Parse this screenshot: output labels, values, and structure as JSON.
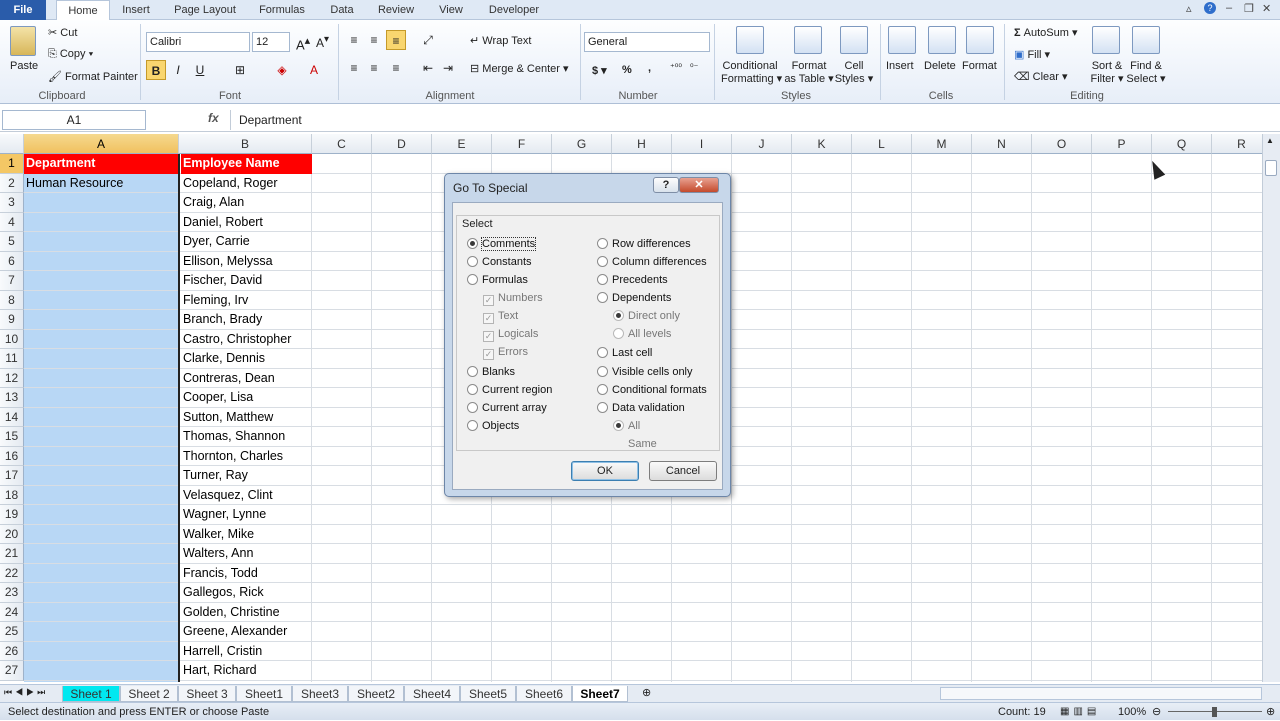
{
  "ribbon_tabs": [
    "File",
    "Home",
    "Insert",
    "Page Layout",
    "Formulas",
    "Data",
    "Review",
    "View",
    "Developer"
  ],
  "clipboard": {
    "paste": "Paste",
    "cut": "Cut",
    "copy": "Copy ▾",
    "format_painter": "Format Painter",
    "label": "Clipboard"
  },
  "font": {
    "name": "Calibri",
    "size": "12",
    "label": "Font",
    "bold": "B",
    "italic": "I",
    "underline": "U"
  },
  "alignment": {
    "wrap": "Wrap Text",
    "merge": "Merge & Center ▾",
    "label": "Alignment"
  },
  "number": {
    "format": "General",
    "label": "Number",
    "currency": "$ ▾",
    "percent": "%",
    "comma": ","
  },
  "styles": {
    "cond1": "Conditional",
    "cond2": "Formatting ▾",
    "fmt1": "Format",
    "fmt2": "as Table ▾",
    "cell1": "Cell",
    "cell2": "Styles ▾",
    "label": "Styles"
  },
  "cells": {
    "insert": "Insert",
    "delete": "Delete",
    "format": "Format",
    "label": "Cells"
  },
  "editing": {
    "autosum": "AutoSum ▾",
    "fill": "Fill ▾",
    "clear": "Clear ▾",
    "sort1": "Sort &",
    "sort2": "Filter ▾",
    "find1": "Find &",
    "find2": "Select ▾",
    "label": "Editing"
  },
  "formula_bar": {
    "name_box": "A1",
    "fx": "fx",
    "content": "Department"
  },
  "columns": [
    "A",
    "B",
    "C",
    "D",
    "E",
    "F",
    "G",
    "H",
    "I",
    "J",
    "K",
    "L",
    "M",
    "N",
    "O",
    "P",
    "Q",
    "R"
  ],
  "rows": [
    "1",
    "2",
    "3",
    "4",
    "5",
    "6",
    "7",
    "8",
    "9",
    "10",
    "11",
    "12",
    "13",
    "14",
    "15",
    "16",
    "17",
    "18",
    "19",
    "20",
    "21",
    "22",
    "23",
    "24",
    "25",
    "26",
    "27"
  ],
  "colA": [
    "Department",
    "Human Resource"
  ],
  "colB": [
    "Employee Name",
    "Copeland, Roger",
    "Craig, Alan",
    "Daniel, Robert",
    "Dyer, Carrie",
    "Ellison, Melyssa",
    "Fischer, David",
    "Fleming, Irv",
    "Branch, Brady",
    "Castro, Christopher",
    "Clarke, Dennis",
    "Contreras, Dean",
    "Cooper, Lisa",
    "Sutton, Matthew",
    "Thomas, Shannon",
    "Thornton, Charles",
    "Turner, Ray",
    "Velasquez, Clint",
    "Wagner, Lynne",
    "Walker, Mike",
    "Walters, Ann",
    "Francis, Todd",
    "Gallegos, Rick",
    "Golden, Christine",
    "Greene, Alexander",
    "Harrell, Cristin",
    "Hart, Richard"
  ],
  "dialog": {
    "title": "Go To Special",
    "help": "?",
    "close": "✕",
    "group": "Select",
    "left_options": [
      "Comments",
      "Constants",
      "Formulas"
    ],
    "formula_subs": [
      "Numbers",
      "Text",
      "Logicals",
      "Errors"
    ],
    "left_options2": [
      "Blanks",
      "Current region",
      "Current array",
      "Objects"
    ],
    "right_options": [
      "Row differences",
      "Column differences",
      "Precedents",
      "Dependents"
    ],
    "dep_subs": [
      "Direct only",
      "All levels"
    ],
    "right_options2": [
      "Last cell",
      "Visible cells only",
      "Conditional formats",
      "Data validation"
    ],
    "dv_subs": [
      "All",
      "Same"
    ],
    "ok": "OK",
    "cancel": "Cancel"
  },
  "sheets": [
    "Sheet 1",
    "Sheet 2",
    "Sheet 3",
    "Sheet1",
    "Sheet3",
    "Sheet2",
    "Sheet4",
    "Sheet5",
    "Sheet6",
    "Sheet7"
  ],
  "status": {
    "message": "Select destination and press ENTER or choose Paste",
    "count": "Count: 19",
    "zoom": "100%"
  }
}
